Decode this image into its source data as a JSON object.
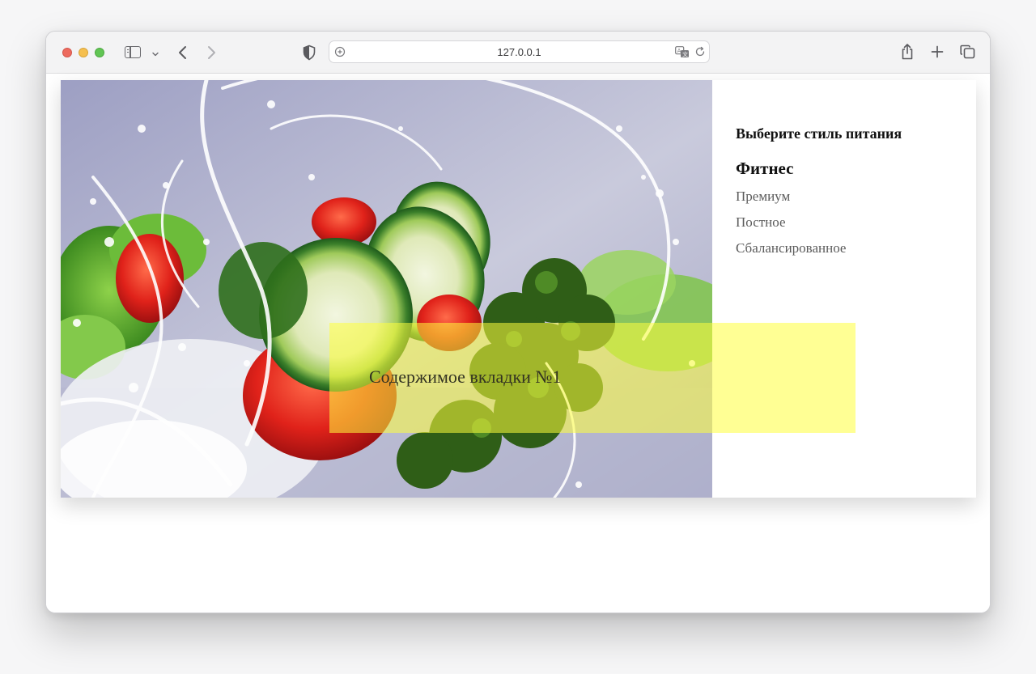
{
  "browser": {
    "url": "127.0.0.1",
    "icons": [
      "sidebar-icon",
      "chevron-down-icon",
      "back-arrow-icon",
      "forward-arrow-icon",
      "shield-icon",
      "site-settings-icon",
      "translate-icon",
      "reload-icon",
      "share-icon",
      "plus-icon",
      "tabs-overview-icon"
    ]
  },
  "page": {
    "menu": {
      "heading": "Выберите стиль питания",
      "items": [
        {
          "label": "Фитнес",
          "active": true
        },
        {
          "label": "Премиум",
          "active": false
        },
        {
          "label": "Постное",
          "active": false
        },
        {
          "label": "Сбалансированное",
          "active": false
        }
      ]
    },
    "tab_content": {
      "text": "Содержимое вкладки №1",
      "background": "#ffff3c"
    },
    "photo": {
      "subject": "vegetables-water-splash-photo"
    }
  },
  "colors": {
    "accent_yellow": "#fafa7a",
    "heading_text": "#111111",
    "menu_text": "#5b5b5b"
  }
}
